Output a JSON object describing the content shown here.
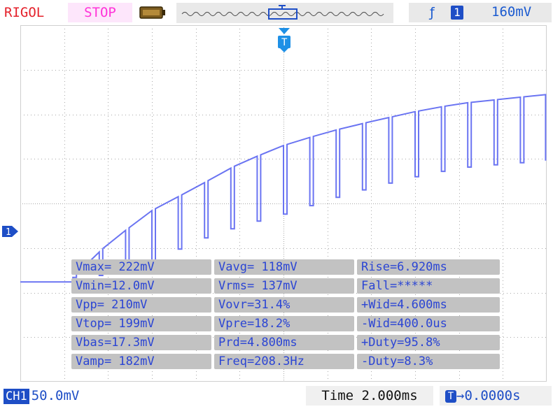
{
  "header": {
    "brand": "RIGOL",
    "run_state": "STOP",
    "trigger_edge_icon": "rising-edge-icon",
    "trigger_channel": "1",
    "trigger_level": "160mV"
  },
  "channel_marker": "1",
  "trigger_marker": "T",
  "measurements": [
    [
      "Vmax= 222mV",
      "Vavg= 118mV",
      "Rise=6.920ms"
    ],
    [
      "Vmin=12.0mV",
      "Vrms= 137mV",
      "Fall=*****"
    ],
    [
      "Vpp= 210mV",
      "Vovr=31.4%",
      "+Wid=4.600ms"
    ],
    [
      "Vtop= 199mV",
      "Vpre=18.2%",
      "-Wid=400.0us"
    ],
    [
      "Vbas=17.3mV",
      "Prd=4.800ms",
      "+Duty=95.8%"
    ],
    [
      "Vamp= 182mV",
      "Freq=208.3Hz",
      "-Duty=8.3%"
    ]
  ],
  "footer": {
    "channel_label": "CH1",
    "channel_scale": "50.0mV",
    "timebase": "Time 2.000ms",
    "trigger_offset_icon": "T",
    "trigger_offset": "0.0000s"
  },
  "colors": {
    "trace": "#6a74f2",
    "brand": "#e4202a",
    "stop": "#ff33d8",
    "accent": "#1e4ec6",
    "grid": "#a8a8a8"
  },
  "chart_data": {
    "type": "line",
    "title": "",
    "xlabel": "",
    "ylabel": "",
    "x_unit": "ms",
    "y_unit": "mV",
    "xlim": [
      -12,
      12
    ],
    "ylim": [
      -100,
      300
    ],
    "grid": true,
    "series": [
      {
        "pulse_period_ms": 4.8,
        "pulse_low_width_ms": 0.4,
        "baseline_mV": 12,
        "start_ms": -9.6,
        "envelope_t_ms": [
          -9.6,
          -8,
          -6,
          -4,
          -2,
          0,
          2,
          4,
          6,
          8,
          11.9
        ],
        "envelope_high_mV": [
          17,
          55,
          92,
          118,
          145,
          165,
          180,
          192,
          203,
          212,
          222
        ],
        "envelope_low_mV": [
          17,
          20,
          35,
          58,
          75,
          88,
          104,
          118,
          130,
          140,
          148
        ]
      }
    ]
  }
}
